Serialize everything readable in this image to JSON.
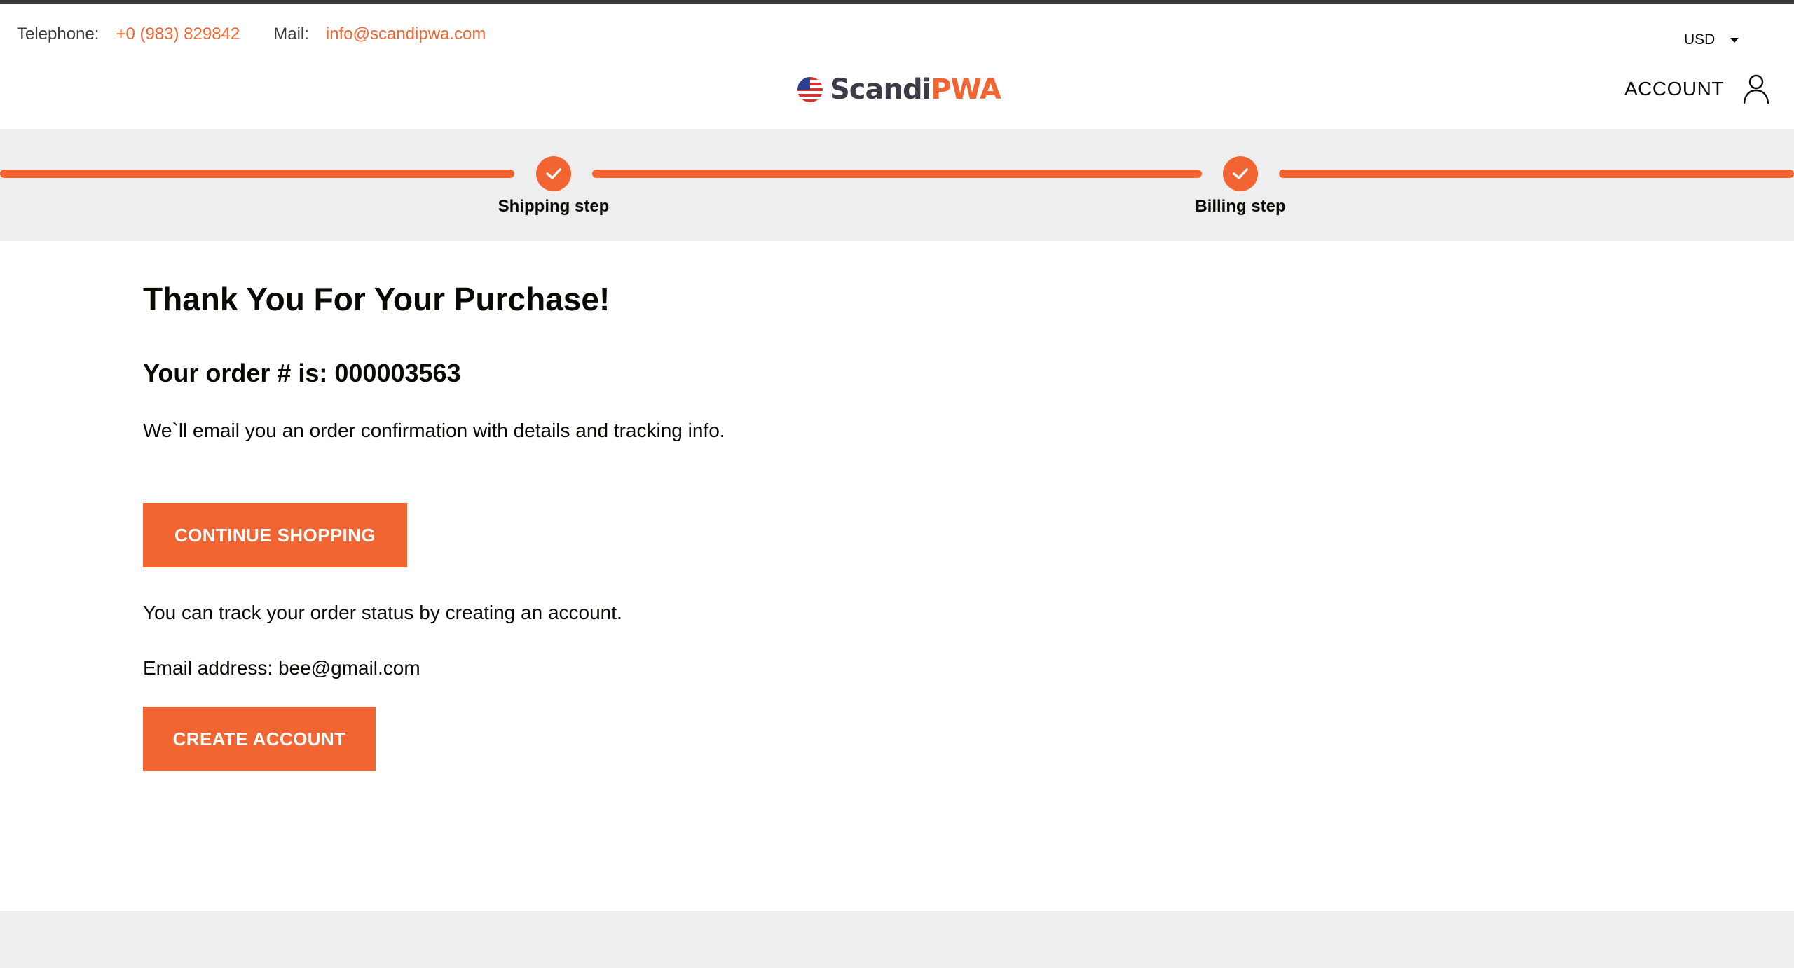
{
  "header": {
    "telephone_label": "Telephone:",
    "telephone_value": "+0 (983) 829842",
    "mail_label": "Mail:",
    "mail_value": "info@scandipwa.com",
    "currency": "USD",
    "logo_text_1": "Scandi",
    "logo_text_2": "PWA",
    "account_label": "ACCOUNT"
  },
  "checkout_progress": {
    "steps": [
      {
        "label": "Shipping step",
        "status": "completed"
      },
      {
        "label": "Billing step",
        "status": "completed"
      }
    ]
  },
  "success": {
    "title": "Thank You For Your Purchase!",
    "order_number_text": "Your order # is: 000003563",
    "confirmation_text": "We`ll email you an order confirmation with details and tracking info.",
    "continue_button": "CONTINUE SHOPPING",
    "track_text": "You can track your order status by creating an account.",
    "email_text": "Email address: bee@gmail.com",
    "create_account_button": "CREATE ACCOUNT"
  },
  "colors": {
    "accent": "#f26532",
    "band_background": "#eeeeee",
    "text": "#0a0903"
  }
}
